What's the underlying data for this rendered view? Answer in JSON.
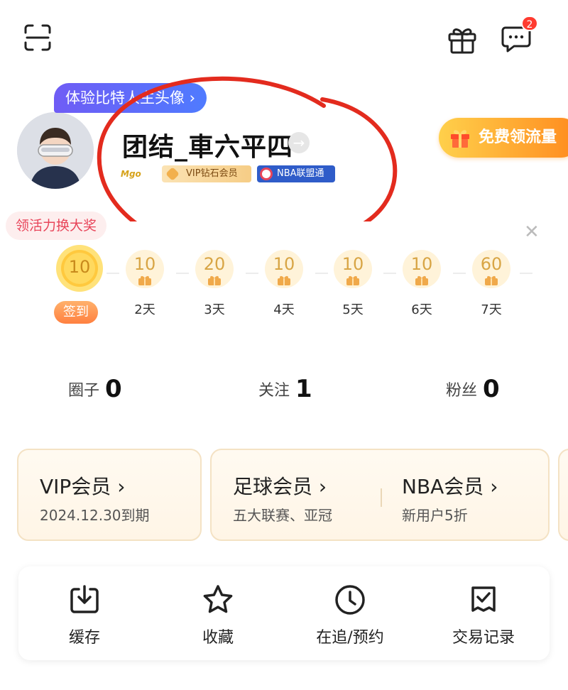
{
  "header": {
    "message_badge": "2"
  },
  "profile": {
    "avatar_tip": "体验比特人主头像 ›",
    "username": "团结_車六平四",
    "arrow": "→",
    "tags": {
      "m_badge": "Mgo",
      "vip": "VIP钻石会员",
      "nba": "NBA联盟通"
    },
    "flow_button": "免费领流量"
  },
  "checkin": {
    "activity_pill": "领活力换大奖",
    "close": "✕",
    "sign_button": "签到",
    "days": [
      {
        "value": "10",
        "label": ""
      },
      {
        "value": "10",
        "label": "2天"
      },
      {
        "value": "20",
        "label": "3天"
      },
      {
        "value": "10",
        "label": "4天"
      },
      {
        "value": "10",
        "label": "5天"
      },
      {
        "value": "10",
        "label": "6天"
      },
      {
        "value": "60",
        "label": "7天"
      }
    ]
  },
  "stats": [
    {
      "label": "圈子",
      "value": "0"
    },
    {
      "label": "关注",
      "value": "1"
    },
    {
      "label": "粉丝",
      "value": "0"
    }
  ],
  "memberships": {
    "vip": {
      "title": "VIP会员 ›",
      "sub": "2024.12.30到期"
    },
    "football": {
      "title": "足球会员 ›",
      "sub": "五大联赛、亚冠"
    },
    "nba": {
      "title": "NBA会员 ›",
      "sub": "新用户5折"
    }
  },
  "tools": [
    {
      "label": "缓存",
      "icon": "download-icon"
    },
    {
      "label": "收藏",
      "icon": "star-icon"
    },
    {
      "label": "在追/预约",
      "icon": "clock-icon"
    },
    {
      "label": "交易记录",
      "icon": "receipt-check-icon"
    }
  ],
  "colors": {
    "accent_red": "#e8455a",
    "highlight_circle": "#e32b1e",
    "coin_gold": "#d8a545",
    "orange": "#ff8a1e"
  }
}
